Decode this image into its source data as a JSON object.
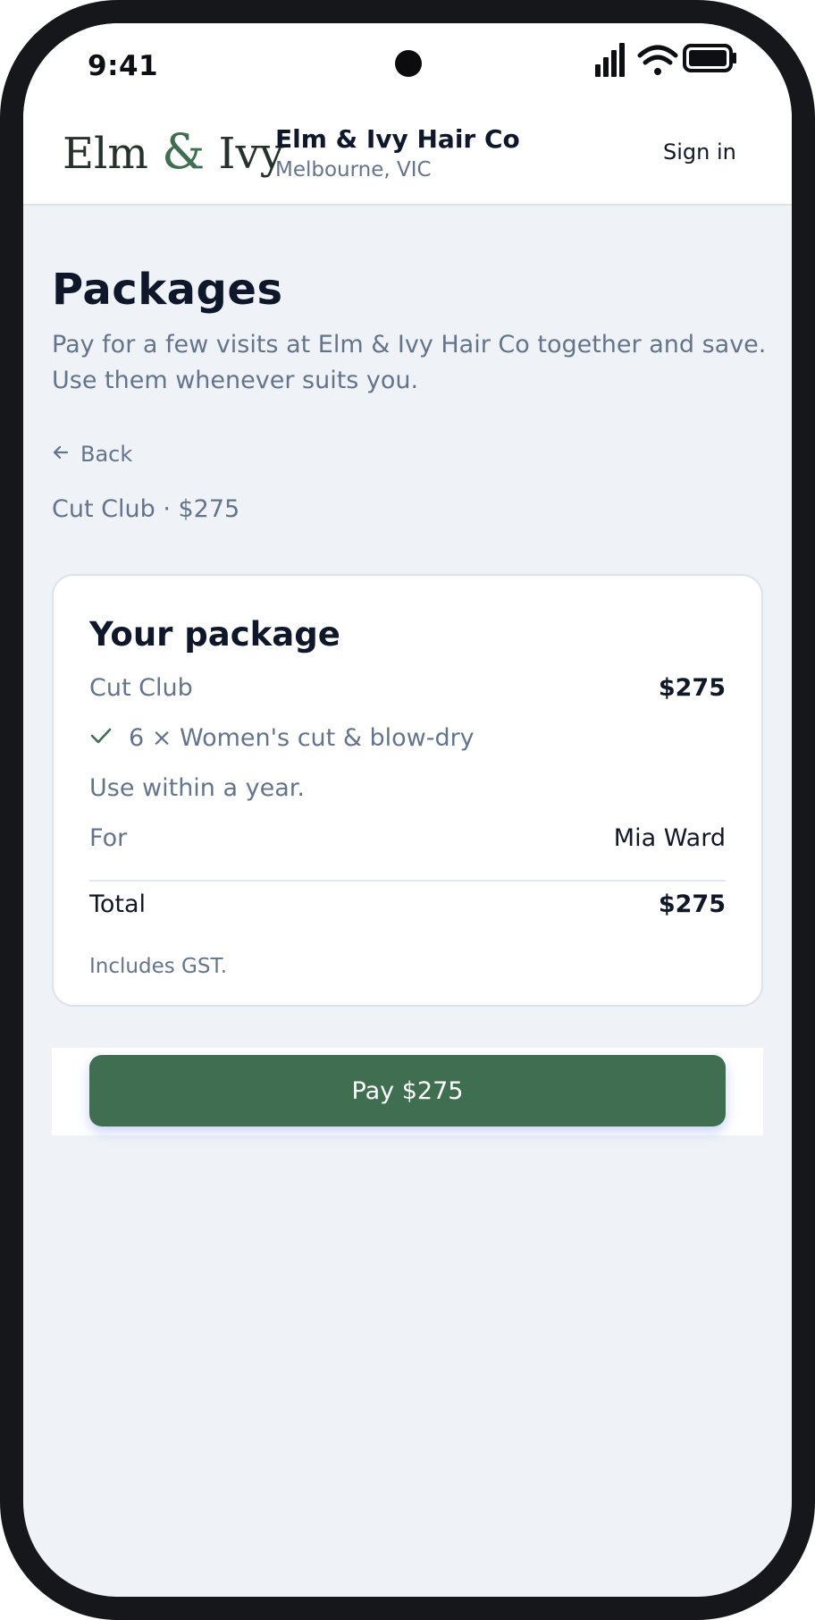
{
  "status_bar": {
    "time": "9:41",
    "icons": [
      "cellular-signal-icon",
      "wifi-icon",
      "battery-icon"
    ]
  },
  "header": {
    "logo": {
      "part1": "Elm",
      "amp": "&",
      "part2": "Ivy"
    },
    "brand_name": "Elm & Ivy Hair Co",
    "location": "Melbourne, VIC",
    "signin_label": "Sign in"
  },
  "page": {
    "title": "Packages",
    "intro": "Pay for a few visits at Elm & Ivy Hair Co together and save. Use them whenever suits you.",
    "back_label": "Back",
    "selected_summary": "Cut Club · $275"
  },
  "package_card": {
    "title": "Your package",
    "package_name": "Cut Club",
    "package_price": "$275",
    "inclusion": "6 × Women's cut & blow-dry",
    "validity": "Use within a year.",
    "for_label": "For",
    "for_value": "Mia Ward",
    "total_label": "Total",
    "total_value": "$275",
    "tax_note": "Includes GST."
  },
  "actions": {
    "pay_label": "Pay $275"
  },
  "colors": {
    "brand_green": "#3f6e51",
    "background": "#eff2f7",
    "text_dark": "#0f172a",
    "text_muted": "#64748b"
  }
}
